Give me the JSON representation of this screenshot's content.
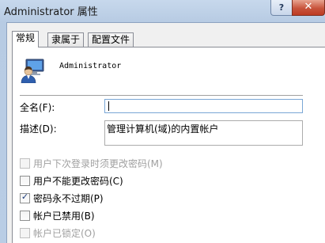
{
  "window": {
    "title": "Administrator 属性",
    "help_label": "?",
    "close_label": "✕"
  },
  "tabs": [
    {
      "label": "常规",
      "active": true
    },
    {
      "label": "隶属于",
      "active": false
    },
    {
      "label": "配置文件",
      "active": false
    }
  ],
  "general": {
    "username": "Administrator",
    "fullname_label": "全名(F):",
    "fullname_value": "",
    "description_label": "描述(D):",
    "description_value": "管理计算机(域)的内置帐户"
  },
  "checkboxes": [
    {
      "label": "用户下次登录时须更改密码(M)",
      "checked": false,
      "enabled": false
    },
    {
      "label": "用户不能更改密码(C)",
      "checked": false,
      "enabled": true
    },
    {
      "label": "密码永不过期(P)",
      "checked": true,
      "enabled": true
    },
    {
      "label": "帐户已禁用(B)",
      "checked": false,
      "enabled": true
    },
    {
      "label": "帐户已锁定(O)",
      "checked": false,
      "enabled": false
    }
  ],
  "icons": {
    "avatar": "user-account-icon",
    "check": "checkmark-icon"
  }
}
